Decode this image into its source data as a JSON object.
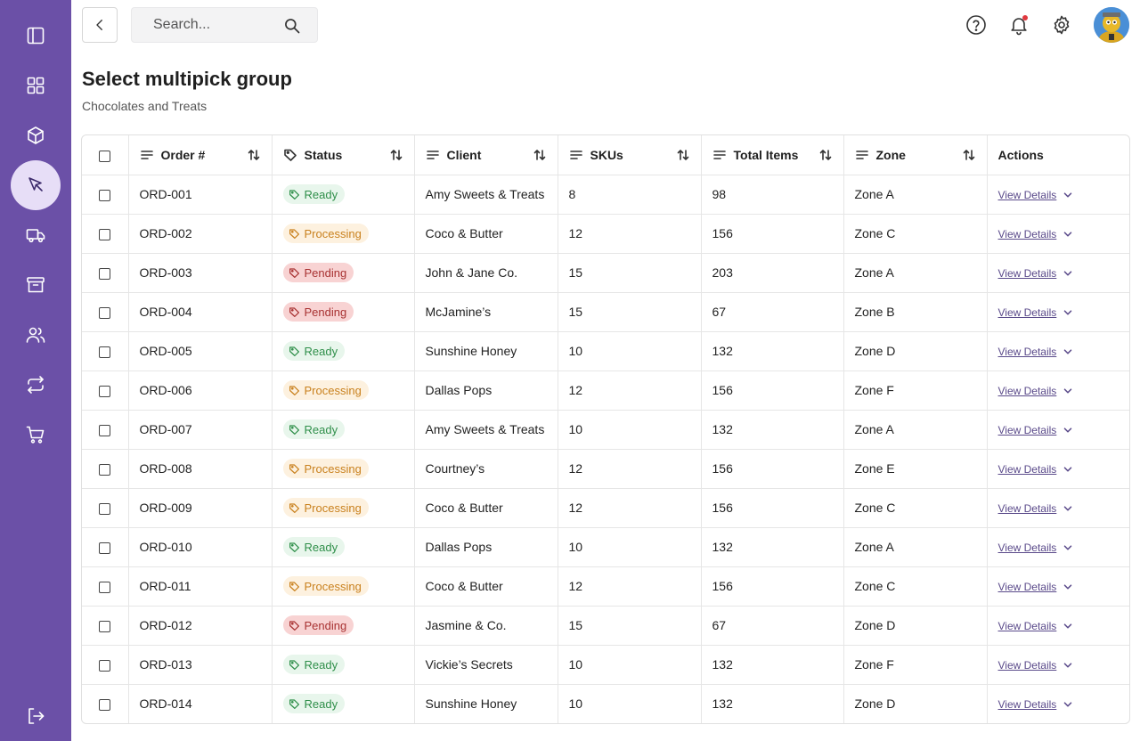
{
  "search": {
    "placeholder": "Search..."
  },
  "header": {
    "title": "Select multipick group",
    "subtitle": "Chocolates and Treats"
  },
  "sidebar": {
    "items": [
      {
        "icon": "sidebar-toggle-icon"
      },
      {
        "icon": "dashboard-grid-icon"
      },
      {
        "icon": "package-box-icon"
      },
      {
        "icon": "cursor-pick-icon",
        "active": true
      },
      {
        "icon": "delivery-truck-icon"
      },
      {
        "icon": "archive-icon"
      },
      {
        "icon": "users-icon"
      },
      {
        "icon": "transfer-arrows-icon"
      },
      {
        "icon": "shopping-cart-icon"
      },
      {
        "icon": "logout-icon"
      }
    ]
  },
  "table": {
    "columns": [
      "Order #",
      "Status",
      "Client",
      "SKUs",
      "Total Items",
      "Zone",
      "Actions"
    ],
    "action_label": "View Details",
    "rows": [
      {
        "order": "ORD-001",
        "status": "Ready",
        "client": "Amy Sweets & Treats",
        "skus": "8",
        "total": "98",
        "zone": "Zone A"
      },
      {
        "order": "ORD-002",
        "status": "Processing",
        "client": "Coco & Butter",
        "skus": "12",
        "total": "156",
        "zone": "Zone C"
      },
      {
        "order": "ORD-003",
        "status": "Pending",
        "client": "John & Jane Co.",
        "skus": "15",
        "total": "203",
        "zone": "Zone A"
      },
      {
        "order": "ORD-004",
        "status": "Pending",
        "client": "McJamine’s",
        "skus": "15",
        "total": "67",
        "zone": "Zone B"
      },
      {
        "order": "ORD-005",
        "status": "Ready",
        "client": "Sunshine Honey",
        "skus": "10",
        "total": "132",
        "zone": "Zone D"
      },
      {
        "order": "ORD-006",
        "status": "Processing",
        "client": "Dallas Pops",
        "skus": "12",
        "total": "156",
        "zone": "Zone F"
      },
      {
        "order": "ORD-007",
        "status": "Ready",
        "client": "Amy Sweets & Treats",
        "skus": "10",
        "total": "132",
        "zone": "Zone A"
      },
      {
        "order": "ORD-008",
        "status": "Processing",
        "client": "Courtney’s",
        "skus": "12",
        "total": "156",
        "zone": "Zone E"
      },
      {
        "order": "ORD-009",
        "status": "Processing",
        "client": "Coco & Butter",
        "skus": "12",
        "total": "156",
        "zone": "Zone C"
      },
      {
        "order": "ORD-010",
        "status": "Ready",
        "client": "Dallas Pops",
        "skus": "10",
        "total": "132",
        "zone": "Zone A"
      },
      {
        "order": "ORD-011",
        "status": "Processing",
        "client": "Coco & Butter",
        "skus": "12",
        "total": "156",
        "zone": "Zone C"
      },
      {
        "order": "ORD-012",
        "status": "Pending",
        "client": "Jasmine & Co.",
        "skus": "15",
        "total": "67",
        "zone": "Zone D"
      },
      {
        "order": "ORD-013",
        "status": "Ready",
        "client": "Vickie’s Secrets",
        "skus": "10",
        "total": "132",
        "zone": "Zone F"
      },
      {
        "order": "ORD-014",
        "status": "Ready",
        "client": "Sunshine Honey",
        "skus": "10",
        "total": "132",
        "zone": "Zone D"
      }
    ]
  },
  "colors": {
    "sidebar_bg": "#6b50a7",
    "sidebar_active": "#e7def7",
    "ready": "#2f8f4a",
    "processing": "#c9811e",
    "pending": "#a83232",
    "link": "#5a4a8a"
  }
}
